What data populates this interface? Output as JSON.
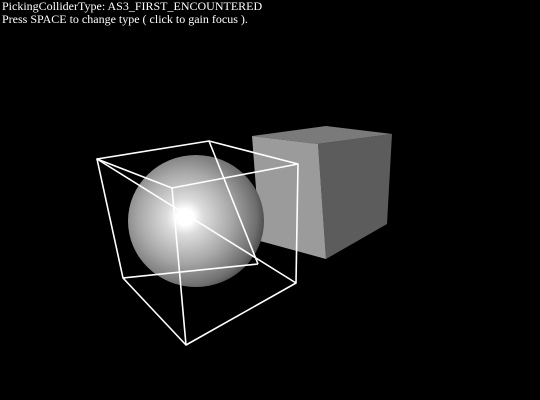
{
  "hud": {
    "collider_type_line": "PickingColliderType: AS3_FIRST_ENCOUNTERED",
    "instruction_line": "Press SPACE to change type ( click to gain focus )."
  },
  "scene": {
    "background_color": "#000000",
    "wireframe_color": "#ffffff",
    "cube_face_front": "#999999",
    "cube_face_top": "#777777",
    "cube_face_side": "#5a5a5a",
    "sphere_highlight": "#ffffff",
    "sphere_shadow": "#3a3a3a"
  }
}
